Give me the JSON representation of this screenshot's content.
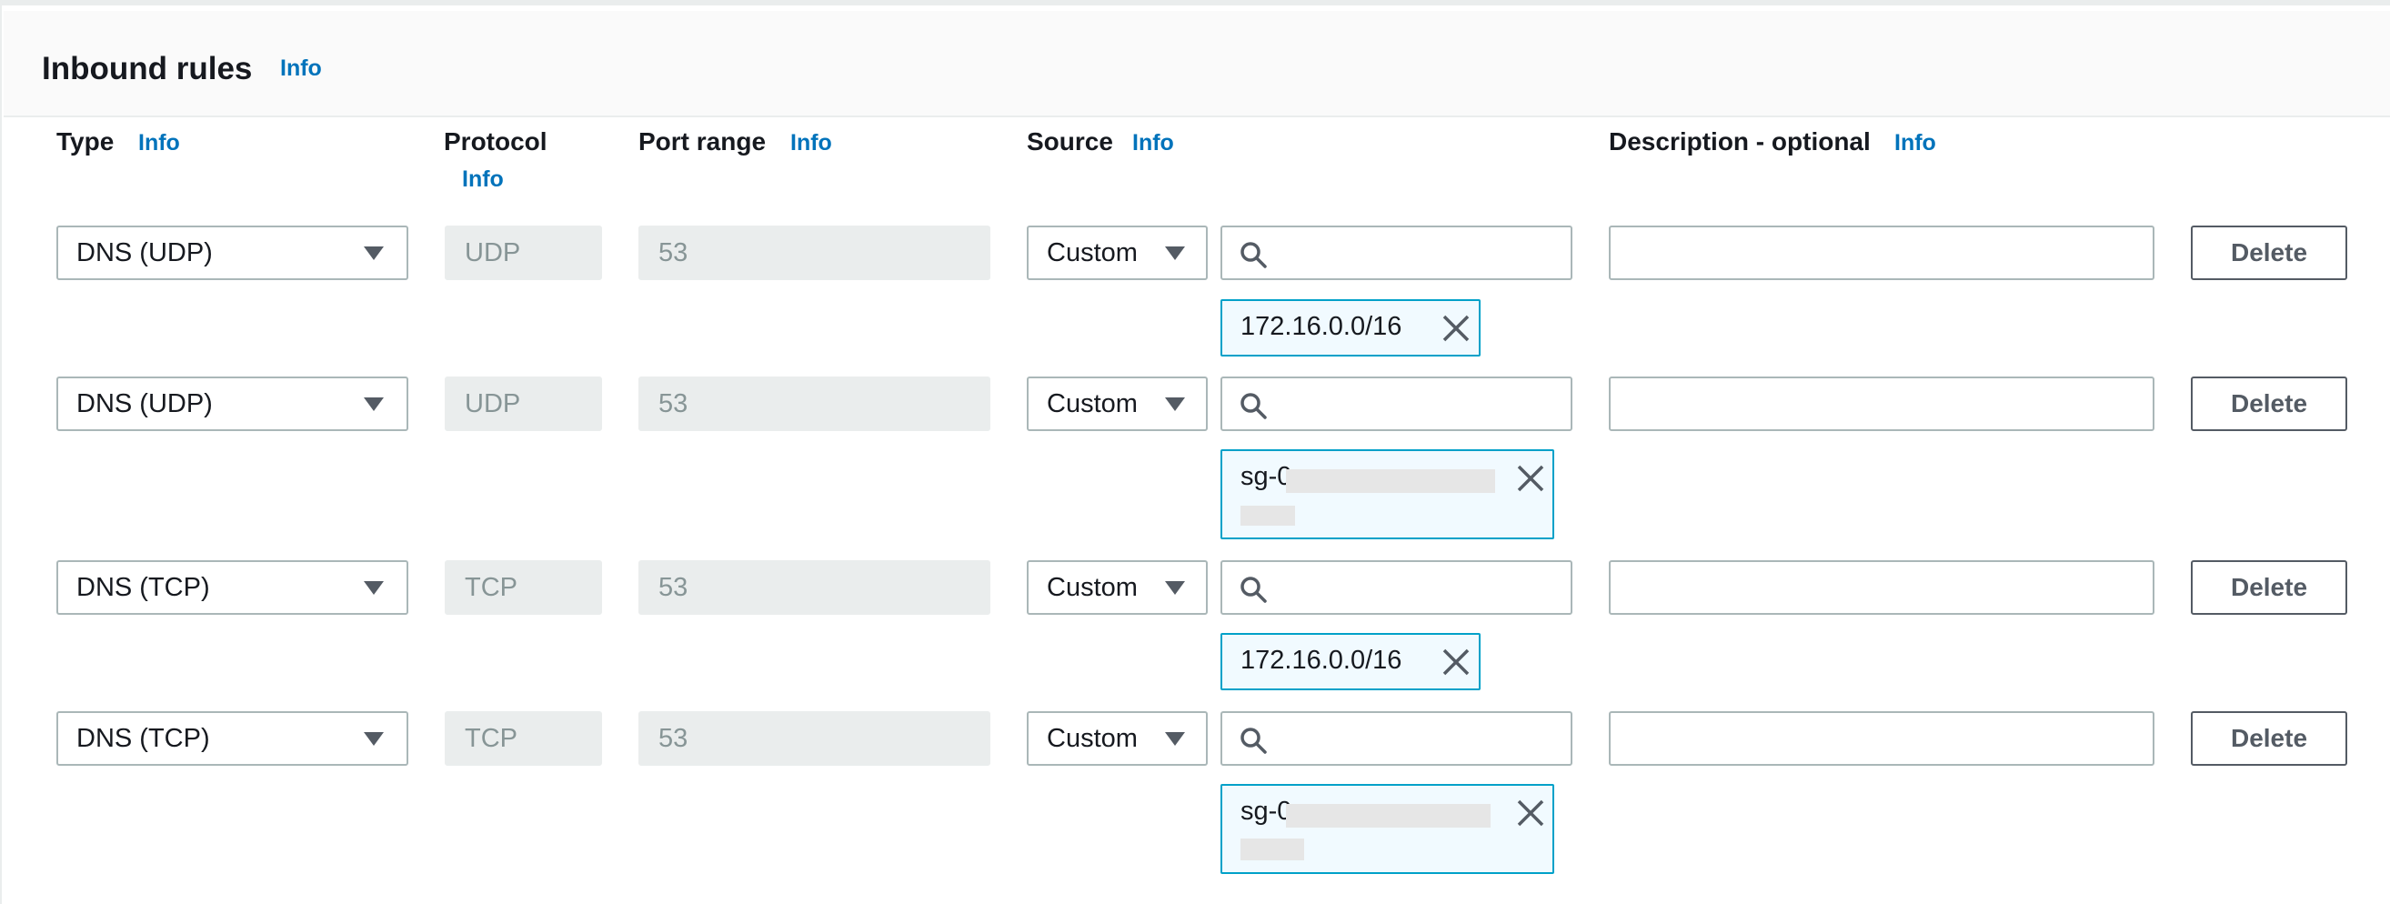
{
  "section": {
    "title": "Inbound rules",
    "info_label": "Info"
  },
  "columns": {
    "type": "Type",
    "protocol": "Protocol",
    "port_range": "Port range",
    "source": "Source",
    "description": "Description - optional",
    "info_label": "Info"
  },
  "rules": [
    {
      "type": "DNS (UDP)",
      "protocol": "UDP",
      "port_range": "53",
      "source_type": "Custom",
      "search_value": "",
      "description": "",
      "token": "172.16.0.0/16",
      "token_redacted": false,
      "delete_label": "Delete"
    },
    {
      "type": "DNS (UDP)",
      "protocol": "UDP",
      "port_range": "53",
      "source_type": "Custom",
      "search_value": "",
      "description": "",
      "token": "sg-0",
      "token_redacted": true,
      "delete_label": "Delete"
    },
    {
      "type": "DNS (TCP)",
      "protocol": "TCP",
      "port_range": "53",
      "source_type": "Custom",
      "search_value": "",
      "description": "",
      "token": "172.16.0.0/16",
      "token_redacted": false,
      "delete_label": "Delete"
    },
    {
      "type": "DNS (TCP)",
      "protocol": "TCP",
      "port_range": "53",
      "source_type": "Custom",
      "search_value": "",
      "description": "",
      "token": "sg-0",
      "token_redacted": true,
      "delete_label": "Delete"
    }
  ],
  "icons": {
    "select_caret": "caret-down-icon",
    "search": "search-icon",
    "token_remove": "close-icon"
  },
  "colors": {
    "link": "#0073bb",
    "token_border": "#00a1c9",
    "token_bg": "#f1faff",
    "disabled_bg": "#eaeded"
  }
}
